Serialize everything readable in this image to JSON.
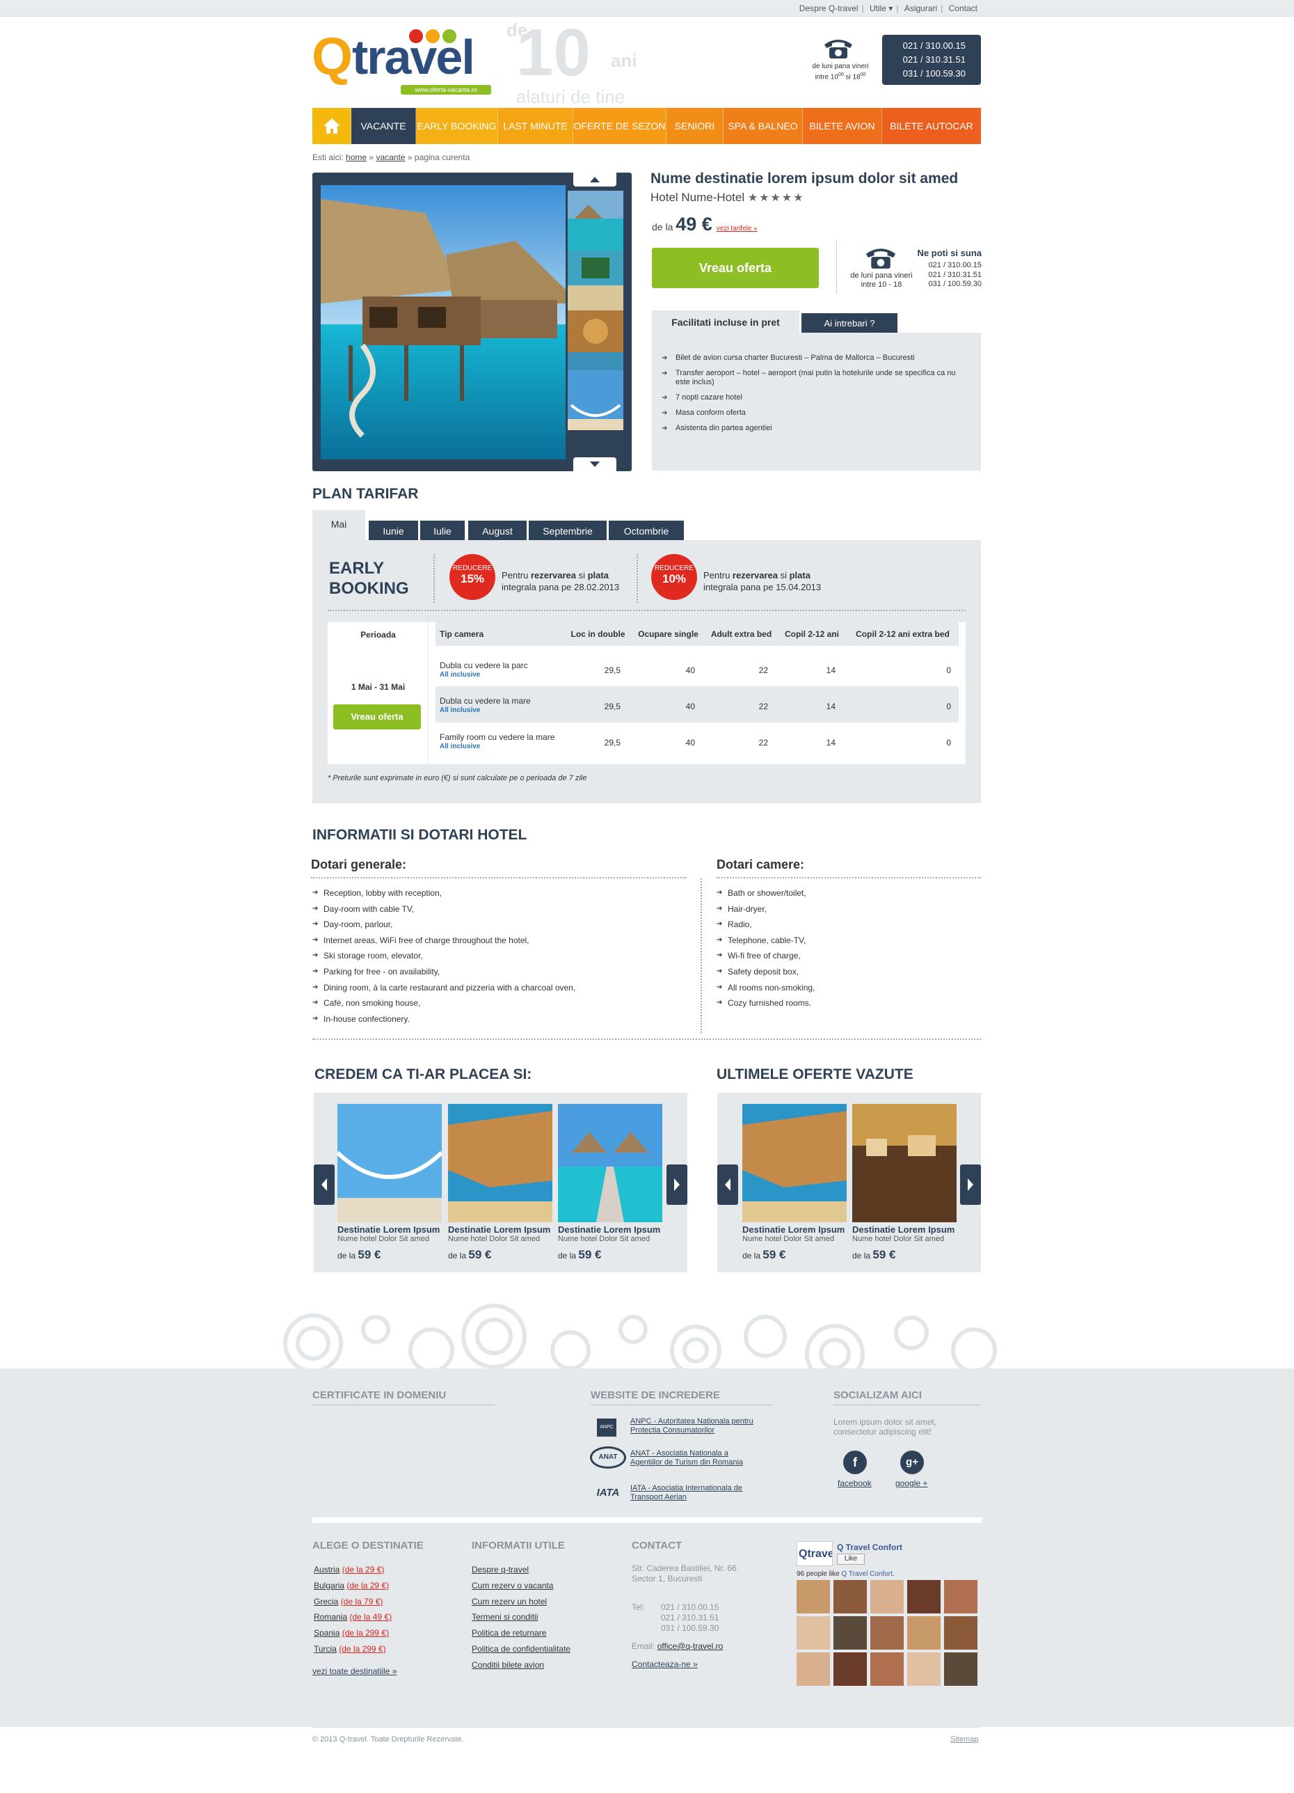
{
  "topbar": {
    "links": [
      "Despre Q-travel",
      "Utile ▾",
      "Asigurari",
      "Contact"
    ]
  },
  "logo": {
    "q": "Q",
    "travel": "travel",
    "url": "www.oferta-vacanta.ro",
    "ten_de": "de",
    "ten_num": "10",
    "ten_ani": "ani",
    "ten_tagline": "alaturi de tine"
  },
  "header_phone": {
    "numbers": [
      "021 / 310.00.15",
      "021 / 310.31.51",
      "031 / 100.59.30"
    ],
    "hours_line1": "de luni pana vineri",
    "hours_line2": "intre 10",
    "hours_sup1": "00",
    "hours_mid": " si 18",
    "hours_sup2": "00"
  },
  "nav": {
    "items": [
      "VACANTE",
      "EARLY BOOKING",
      "LAST MINUTE",
      "OFERTE DE SEZON",
      "SENIORI",
      "SPA & BALNEO",
      "BILETE AVION",
      "BILETE AUTOCAR"
    ],
    "colors": [
      "#2f4156",
      "#f5a514",
      "#f5a514",
      "#f59a14",
      "#f28a18",
      "#f07a1a",
      "#ee6a1c",
      "#ec5a1e"
    ]
  },
  "breadcrumb": {
    "prefix": "Esti aici:",
    "home": "home",
    "vacante": "vacante",
    "current": "pagina curenta",
    "sep": "»"
  },
  "offer": {
    "title": "Nume destinatie lorem ipsum dolor sit amed",
    "hotel": "Hotel Nume-Hotel",
    "stars": "★★★★★",
    "price_prefix": "de la",
    "price": "49 €",
    "tariffs_link": "vezi tarifele »",
    "cta": "Vreau oferta"
  },
  "call": {
    "title": "Ne poti si suna",
    "numbers": [
      "021 / 310.00.15",
      "021 / 310.31.51",
      "031 / 100.59.30"
    ],
    "hours_line1": "de luni pana vineri",
    "hours_line2": "intre 10 - 18"
  },
  "facilities": {
    "tab_active": "Facilitati incluse in pret",
    "tab_other": "Ai intrebari ?",
    "items": [
      "Bilet de avion cursa charter Bucuresti – Palma de Mallorca – Bucuresti",
      "Transfer aeroport – hotel – aeroport (mai putin la hotelurile unde se specifica ca nu este inclus)",
      "7 nopti cazare hotel",
      "Masa conform oferta",
      "Asistenta din partea agentiei"
    ]
  },
  "plan": {
    "title": "PLAN TARIFAR",
    "months": [
      "Mai",
      "Iunie",
      "Iulie",
      "August",
      "Septembrie",
      "Octombrie"
    ],
    "eb_line1": "EARLY",
    "eb_line2": "BOOKING",
    "discounts": [
      {
        "label": "REDUCERE",
        "pct": "15%",
        "t1": "Pentru ",
        "b1": "rezervarea",
        "t2": " si ",
        "b2": "plata",
        "t3": "integrala pana pe 28.02.2013"
      },
      {
        "label": "REDUCERE",
        "pct": "10%",
        "t1": "Pentru ",
        "b1": "rezervarea",
        "t2": " si ",
        "b2": "plata",
        "t3": "integrala pana pe 15.04.2013"
      }
    ],
    "period_header": "Perioada",
    "period": "1 Mai - 31 Mai",
    "period_cta": "Vreau oferta",
    "columns": [
      "Tip camera",
      "Loc in double",
      "Ocupare single",
      "Adult extra bed",
      "Copil 2-12 ani",
      "Copil 2-12 ani extra bed"
    ],
    "rows": [
      {
        "room": "Dubla cu vedere la parc",
        "meal": "All inclusive",
        "v": [
          "29,5",
          "40",
          "22",
          "14",
          "0"
        ]
      },
      {
        "room": "Dubla cu vedere la mare",
        "meal": "All inclusive",
        "v": [
          "29,5",
          "40",
          "22",
          "14",
          "0"
        ]
      },
      {
        "room": "Family room cu vedere la mare",
        "meal": "All inclusive",
        "v": [
          "29,5",
          "40",
          "22",
          "14",
          "0"
        ]
      }
    ],
    "note": "* Preturile sunt exprimate in euro (€) si sunt calculate pe o perioada de 7 zile"
  },
  "info": {
    "title": "INFORMATII SI DOTARI HOTEL",
    "general_title": "Dotari generale:",
    "general": [
      "Reception, lobby with reception,",
      "Day-room with cable TV,",
      "Day-room, parlour,",
      "Internet areas, WiFi free of charge throughout the hotel,",
      "Ski storage room, elevator,",
      "Parking for free - on availability,",
      "Dining room, à la carte restaurant and pizzeria with a charcoal oven,",
      "Café, non smoking house,",
      "In-house confectionery."
    ],
    "rooms_title": "Dotari camere:",
    "rooms": [
      "Bath or shower/toilet,",
      "Hair-dryer,",
      "Radio,",
      "Telephone, cable-TV,",
      "Wi-fi free of charge,",
      "Safety deposit box,",
      "All rooms non-smoking,",
      "Cozy furnished rooms."
    ]
  },
  "suggest": {
    "title": "CREDEM CA TI-AR PLACEA SI:",
    "cards": [
      {
        "name": "Destinatie Lorem Ipsum",
        "hotel": "Nume hotel Dolor Sit amed",
        "prefix": "de la",
        "price": "59 €"
      },
      {
        "name": "Destinatie Lorem Ipsum",
        "hotel": "Nume hotel Dolor Sit amed",
        "prefix": "de la",
        "price": "59 €"
      },
      {
        "name": "Destinatie Lorem Ipsum",
        "hotel": "Nume hotel Dolor Sit amed",
        "prefix": "de la",
        "price": "59 €"
      }
    ]
  },
  "recent": {
    "title": "ULTIMELE OFERTE VAZUTE",
    "cards": [
      {
        "name": "Destinatie Lorem Ipsum",
        "hotel": "Nume hotel Dolor Sit amed",
        "prefix": "de la",
        "price": "59 €"
      },
      {
        "name": "Destinatie Lorem Ipsum",
        "hotel": "Nume hotel Dolor Sit amed",
        "prefix": "de la",
        "price": "59 €"
      }
    ]
  },
  "footer": {
    "cert_title": "CERTIFICATE IN DOMENIU",
    "trust_title": "WEBSITE DE INCREDERE",
    "trust": [
      {
        "badge": "ANPC",
        "text1": "ANPC - Autoritatea Nationala pentru",
        "text2": "Protectia Consumatorilor"
      },
      {
        "badge": "ANAT",
        "text1": "ANAT - Asociatia Nationala a",
        "text2": "Agentiilor de Turism din Romania"
      },
      {
        "badge": "IATA",
        "text1": "IATA - Asociatia Internationala de",
        "text2": "Transport Aerian"
      }
    ],
    "social_title": "SOCIALIZAM AICI",
    "social_text1": "Lorem ipsum dolor sit amet,",
    "social_text2": "consectetur adipiscing elit!",
    "facebook": "facebook",
    "google": "google +",
    "fb_glyph": "f",
    "g_glyph": "g+",
    "dest_title": "ALEGE O DESTINATIE",
    "destinations": [
      {
        "name": "Austria",
        "price": "(de la 29 €)"
      },
      {
        "name": "Bulgaria",
        "price": "(de la 29 €)"
      },
      {
        "name": "Grecia",
        "price": "(de la 79 €)"
      },
      {
        "name": "Romania",
        "price": "(de la 49 €)"
      },
      {
        "name": "Spania",
        "price": "(de la 299 €)"
      },
      {
        "name": "Turcia",
        "price": "(de la 299 €)"
      }
    ],
    "all_dest": "vezi toate destinatiile »",
    "info_title": "INFORMATII UTILE",
    "info_links": [
      "Despre q-travel",
      "Cum rezerv o vacanta",
      "Cum rezerv un hotel",
      "Termeni si conditii",
      "Politica de returnare",
      "Politica de confidentialitate",
      "Conditii bilete avion"
    ],
    "contact_title": "CONTACT",
    "address1": "Str. Caderea Bastiliei, Nr. 66",
    "address2": "Sector 1, Bucuresti",
    "tel_label": "Tel:",
    "tels": [
      "021 / 310.00.15",
      "021 / 310.31.51",
      "031 / 100.59.30"
    ],
    "email_label": "Email:",
    "email": "office@q-travel.ro",
    "contact_link": "Contacteaza-ne »",
    "fb_page": "Q Travel Confort",
    "fb_like": "Like",
    "fb_count": "96 people like ",
    "fb_count_link": "Q Travel Confort."
  },
  "copyright": "© 2013 Q-travel. Toate Drepturile Rezervate.",
  "sitemap": "Sitemap"
}
